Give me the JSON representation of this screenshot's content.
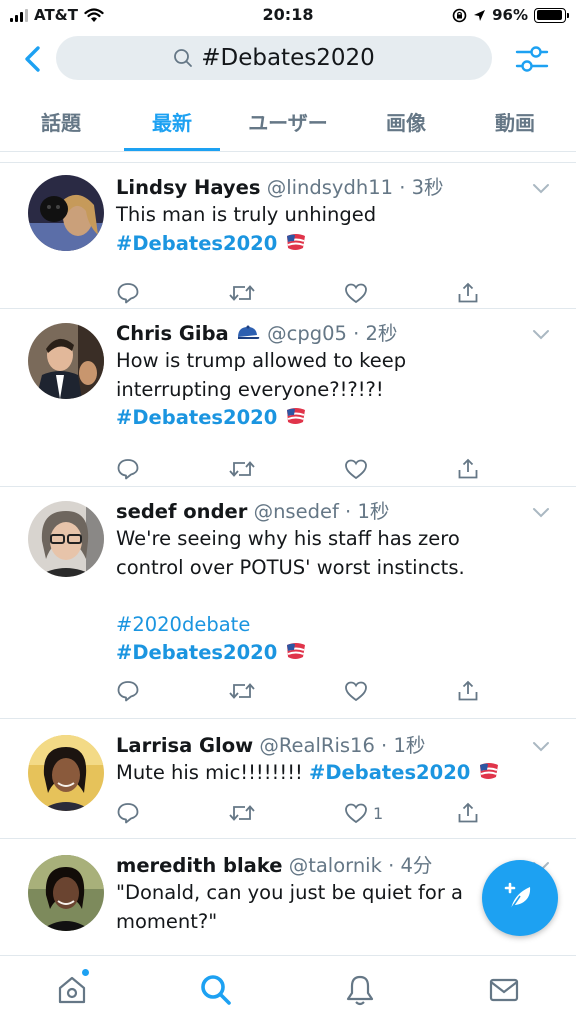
{
  "status_bar": {
    "carrier": "AT&T",
    "time": "20:18",
    "battery": "96%",
    "battery_level": 0.96
  },
  "search": {
    "query": "#Debates2020"
  },
  "tabs": [
    {
      "label": "話題",
      "active": false
    },
    {
      "label": "最新",
      "active": true
    },
    {
      "label": "ユーザー",
      "active": false
    },
    {
      "label": "画像",
      "active": false
    },
    {
      "label": "動画",
      "active": false
    }
  ],
  "tweets": [
    {
      "name": "Lindsy Hayes",
      "handle": "@lindsydh11",
      "time": "3秒",
      "text_lines": [
        "This man is truly unhinged"
      ],
      "hashtag": "#Debates2020",
      "likes": ""
    },
    {
      "name": "Chris Giba",
      "handle": "@cpg05",
      "time": "2秒",
      "text_lines": [
        "How is trump allowed to keep",
        "interrupting everyone?!?!?!"
      ],
      "hashtag": "#Debates2020",
      "likes": ""
    },
    {
      "name": "sedef onder",
      "handle": "@nsedef",
      "time": "1秒",
      "text_lines": [
        "We're seeing why his staff has zero",
        "control over POTUS' worst instincts."
      ],
      "extra_hashtag": "#2020debate",
      "hashtag": "#Debates2020",
      "likes": ""
    },
    {
      "name": "Larrisa Glow",
      "handle": "@RealRis16",
      "time": "1秒",
      "text_inline": "Mute his mic!!!!!!!! ",
      "hashtag": "#Debates2020",
      "likes": "1"
    },
    {
      "name": "meredith blake",
      "handle": "@talornik",
      "time": "4分",
      "text_lines": [
        "\"Donald, can you just be quiet for a",
        "moment?\""
      ]
    }
  ],
  "separator": " · ",
  "colors": {
    "accent": "#1da1f2",
    "hashtag": "#1b95e0",
    "secondary": "#657786",
    "divider": "#e1e8ed"
  }
}
